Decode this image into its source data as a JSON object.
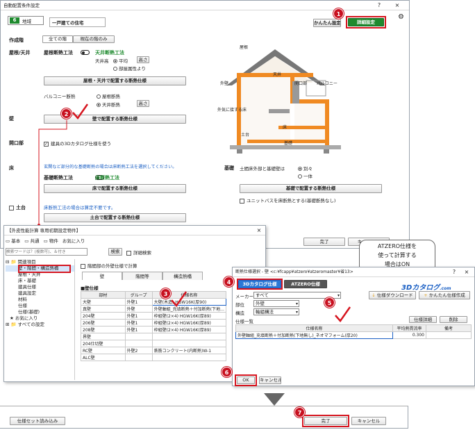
{
  "main_window": {
    "title": "自動配置条件設定",
    "help_glyph": "?",
    "close_glyph": "×",
    "region_number": "6",
    "region_suffix": "地域",
    "house_type": "一戸建ての住宅",
    "simple_settings_button": "かんたん設定",
    "detail_settings_button": "詳細設定",
    "floor_label": "作成階",
    "floor_tabs": [
      "全ての階",
      "現在の階のみ"
    ],
    "roof_label": "屋根/天井",
    "roof_insulation_method": "屋根断熱工法",
    "ceiling_insulation_method": "天井断熱工法",
    "ceiling_height_label": "天井高",
    "option_average": "平均",
    "height_button": "高さ",
    "option_by_room_attr": "部屋属性より",
    "roof_ceiling_button": "屋根・天井で配置する断熱仕様",
    "balcony_label": "バルコニー断熱",
    "balcony_option_roof": "屋根断熱",
    "balcony_option_ceiling": "天井断熱",
    "wall_label": "壁",
    "wall_button": "壁で配置する断熱仕様",
    "opening_label": "開口部",
    "opening_checkbox": "建具の3Dカタログ仕様を使う",
    "floor_section_label": "床",
    "floor_note": "玄関など部分的な基礎断熱の場合は床断熱工法を選択してください。",
    "foundation_insulation": "基礎断熱工法",
    "floor_insulation": "床断熱工法",
    "floor_button": "床で配置する断熱仕様",
    "foundation_label": "基礎",
    "foundation_question": "土間床外部と基礎壁は",
    "foundation_option_separate": "別々",
    "foundation_option_same": "一体",
    "foundation_button": "基礎で配置する断熱仕様",
    "unit_bath_checkbox": "ユニットバスを床断熱とする(基礎断熱なし)",
    "earth_floor_label": "土台",
    "earth_floor_note": "床断熱工法の場合は算定不要です。",
    "earth_floor_button": "土台で配置する断熱仕様",
    "ok_button": "完了",
    "cancel_button": "キャンセル"
  },
  "diagram": {
    "roof": "屋根",
    "ceiling": "天井",
    "exterior_wall": "外壁",
    "opening": "開口部",
    "balcony": "バルコニー",
    "floor_on_exterior_air": "外気に接する床",
    "floor": "床",
    "earth_floor": "土台",
    "foundation": "基礎"
  },
  "library_window": {
    "title": "【外皮性能計算 専用初期設定物件】",
    "tabs": [
      "基本",
      "共通",
      "物件",
      "お気に入り"
    ],
    "search_placeholder": "検索ワードは？(複数可)、＆付き",
    "search_button": "検索",
    "detail_search": "詳細検索",
    "tree_root": "関連項目",
    "tree_items": [
      "壁・階間・構造熱橋",
      "屋根・天井",
      "床・基礎",
      "建具仕様",
      "建具設定",
      "材料",
      "仕様",
      "仕様(基礎)"
    ],
    "favorites": "お気に入り",
    "all_settings": "すべての設定",
    "interfloor_checkbox": "階間部の外壁仕様で計算",
    "sub_tabs": [
      "壁",
      "階間等",
      "構造熱橋"
    ],
    "wall_spec_heading": "■壁仕様",
    "table_headers": [
      "部材",
      "グループ",
      "仕様名称"
    ],
    "rows": [
      [
        "大壁",
        "外壁1",
        "大壁(木造) HGW16K(厚90)"
      ],
      [
        "真壁",
        "外壁",
        "外壁軸組_充填断熱＋付加断熱(下地…"
      ],
      [
        "204壁",
        "外壁1",
        "枠組壁(2×4) HGW16K(厚89)"
      ],
      [
        "206壁",
        "外壁1",
        "枠組壁(2×4) HGW16K(厚89)"
      ],
      [
        "208壁",
        "外壁1",
        "枠組壁(2×4) HGW16K(厚89)"
      ],
      [
        "界壁",
        "",
        ""
      ],
      [
        "204仕切壁",
        "",
        ""
      ],
      [
        "RC壁",
        "外壁2",
        "鉄筋コンクリート(内断熱)W-1"
      ],
      [
        "ALC壁",
        "",
        ""
      ]
    ]
  },
  "spec_window": {
    "title": "断熱仕様選択 - 壁 <c:¥fcapp¥atzero¥atzeromaster¥省13>",
    "tab_3d_catalog": "3Dカタログ仕様",
    "tab_atzero": "ATZERO仕様",
    "maker_label": "メーカー",
    "maker_value": "すべて",
    "part_label": "部位",
    "part_value": "外壁",
    "structure_label": "構造",
    "structure_value": "軸組構法",
    "list_label": "仕様一覧",
    "catalog_logo": "3Dカタログ",
    "catalog_logo_suffix": ".com",
    "download_button": "仕様ダウンロード",
    "easy_create_button": "かんたん仕様作成",
    "detail_button": "仕様詳細",
    "delete_button": "削除",
    "col_name": "仕様名称",
    "col_u_value": "平均熱貫流率",
    "col_note": "備考",
    "row_name": "外壁軸組_充填断熱＋付加断熱(下地無し)_ネオマフォーム(厚20)",
    "row_u_value": "0.300",
    "ok_button": "OK",
    "cancel_button": "キャンセル"
  },
  "callout": {
    "text_line1": "ATZERO仕様を",
    "text_line2": "使って計算する",
    "text_line3": "場合はON"
  },
  "bottom_bar": {
    "load_button": "仕様セット読み込み",
    "ok_button": "完了",
    "cancel_button": "キャンセル"
  },
  "markers": [
    "1",
    "2",
    "3",
    "4",
    "5",
    "6",
    "7"
  ],
  "colors": {
    "marker_red": "#c8101f",
    "accent_green": "#1e8a2e",
    "insulation_orange": "#f08a22",
    "selected_blue": "#1a5fc4"
  }
}
